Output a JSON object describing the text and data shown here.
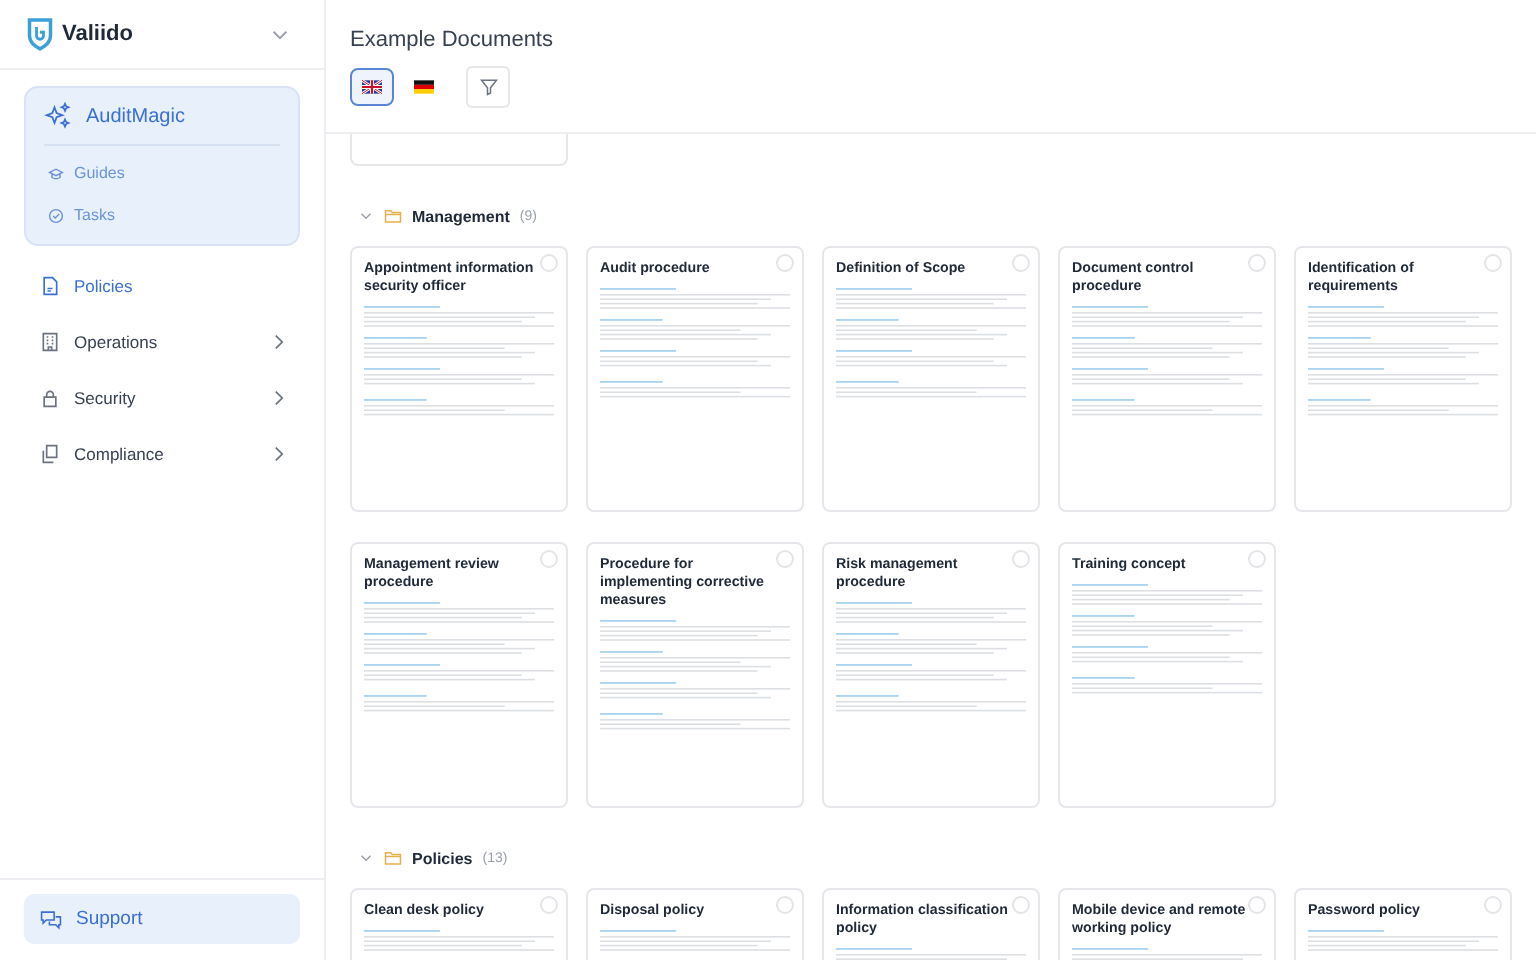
{
  "sidebar": {
    "logo": "Valiido",
    "magic": {
      "title": "AuditMagic",
      "items": [
        {
          "label": "Guides"
        },
        {
          "label": "Tasks"
        }
      ]
    },
    "nav": [
      {
        "label": "Policies",
        "selected": true,
        "expandable": false
      },
      {
        "label": "Operations",
        "selected": false,
        "expandable": true
      },
      {
        "label": "Security",
        "selected": false,
        "expandable": true
      },
      {
        "label": "Compliance",
        "selected": false,
        "expandable": true
      }
    ],
    "support": "Support"
  },
  "header": {
    "title": "Example Documents",
    "languages": [
      {
        "kind": "english",
        "selected": true
      },
      {
        "kind": "german",
        "selected": false
      }
    ]
  },
  "groups": [
    {
      "name": "Management",
      "count": "(9)",
      "expanded": true,
      "cards": [
        {
          "title": "Appointment information security officer",
          "selected": false
        },
        {
          "title": "Audit procedure",
          "selected": false
        },
        {
          "title": "Definition of Scope",
          "selected": false
        },
        {
          "title": "Document control procedure",
          "selected": false
        },
        {
          "title": "Identification of requirements",
          "selected": false
        },
        {
          "title": "Management review procedure",
          "selected": false
        },
        {
          "title": "Procedure for implementing corrective measures",
          "selected": false
        },
        {
          "title": "Risk management procedure",
          "selected": false
        },
        {
          "title": "Training concept",
          "selected": false
        }
      ]
    },
    {
      "name": "Policies",
      "count": "(13)",
      "expanded": true,
      "cards": [
        {
          "title": "Clean desk policy",
          "selected": false
        },
        {
          "title": "Disposal policy",
          "selected": false
        },
        {
          "title": "Information classification policy",
          "selected": false
        },
        {
          "title": "Mobile device and remote working policy",
          "selected": false
        },
        {
          "title": "Password policy",
          "selected": false
        }
      ]
    }
  ]
}
